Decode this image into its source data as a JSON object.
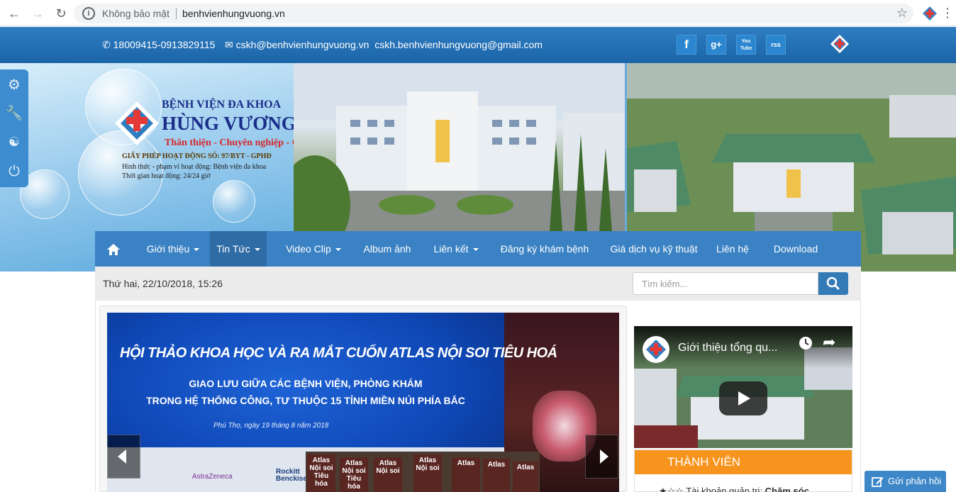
{
  "browser": {
    "insecure_label": "Không bảo mật",
    "url": "benhvienhungvuong.vn"
  },
  "topbar": {
    "phone": "18009415-0913829115",
    "email_1": "cskh@benhvienhungvuong.vn",
    "email_2": "cskh.benhvienhungvuong@gmail.com",
    "social": [
      "f",
      "g+",
      "You Tube",
      "rss"
    ]
  },
  "brand": {
    "line1": "BỆNH VIỆN ĐA KHOA",
    "line2": "HÙNG VƯƠNG",
    "slogan": "Thân thiện - Chuyên nghiệp - Chu đáo",
    "license": "GIẤY PHÉP HOẠT ĐỘNG SỐ: 97/BYT - GPHĐ",
    "type": "Hình thức - phạm vi hoạt động: Bệnh viện đa khoa",
    "time": "Thời gian hoạt động: 24/24 giờ"
  },
  "nav": {
    "items": [
      {
        "label": "Giới thiệu"
      },
      {
        "label": "Tin Tức"
      },
      {
        "label": "Video Clip"
      },
      {
        "label": "Album ảnh"
      },
      {
        "label": "Liên kết"
      },
      {
        "label": "Đăng ký khám bệnh"
      },
      {
        "label": "Giá dịch vụ kỹ thuật"
      },
      {
        "label": "Liên hệ"
      },
      {
        "label": "Download"
      }
    ]
  },
  "strip": {
    "date": "Thứ hai, 22/10/2018, 15:26",
    "search_placeholder": "Tìm kiếm..."
  },
  "slide": {
    "title": "HỘI THẢO KHOA HỌC VÀ RA MẮT CUỐN ATLAS NỘI SOI TIÊU HOÁ",
    "sub1": "GIAO LƯU GIỮA CÁC BỆNH VIỆN, PHÒNG KHÁM",
    "sub2": "TRONG HỆ THỐNG CÔNG, TƯ THUỘC 15 TỈNH MIỀN NÚI PHÍA BẮC",
    "date": "Phú Thọ, ngày 19 tháng 8 năm 2018",
    "sponsors": [
      "AstraZeneca",
      "Rockitt Benckiser"
    ],
    "books": [
      "Atlas Nội soi Tiêu hóa",
      "Atlas Nội soi Tiêu hóa",
      "Atlas Nội soi",
      "Atlas Nội soi",
      "Atlas",
      "Atlas",
      "Atlas"
    ]
  },
  "video": {
    "title": "Giới thiệu tổng qu..."
  },
  "members": {
    "title": "THÀNH VIÊN",
    "row": "Tài khoản quản trị:",
    "row_value": "Chăm sóc"
  },
  "feedback": {
    "label": "Gửi phản hồi"
  },
  "colors": {
    "brand_blue": "#3b82c4",
    "orange": "#f7941d",
    "red": "#d7262a"
  }
}
